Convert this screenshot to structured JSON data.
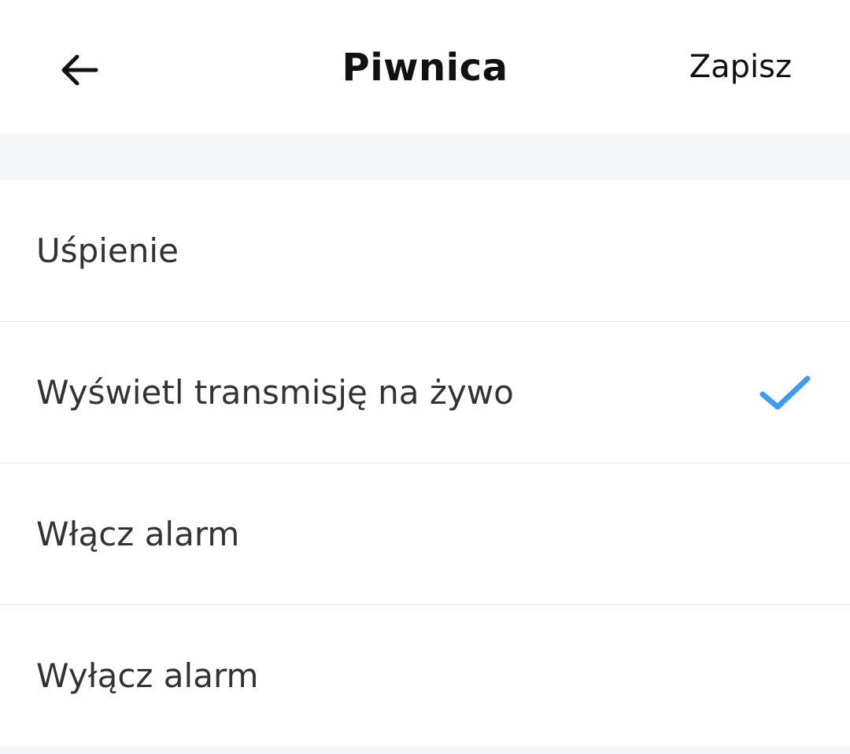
{
  "header": {
    "title": "Piwnica",
    "save_label": "Zapisz",
    "back_icon": "arrow-left-icon"
  },
  "options": [
    {
      "label": "Uśpienie",
      "selected": false
    },
    {
      "label": "Wyświetl transmisję na żywo",
      "selected": true
    },
    {
      "label": "Włącz alarm",
      "selected": false
    },
    {
      "label": "Wyłącz alarm",
      "selected": false
    }
  ],
  "colors": {
    "check": "#3a9df2",
    "background_gray": "#f4f5f9"
  }
}
